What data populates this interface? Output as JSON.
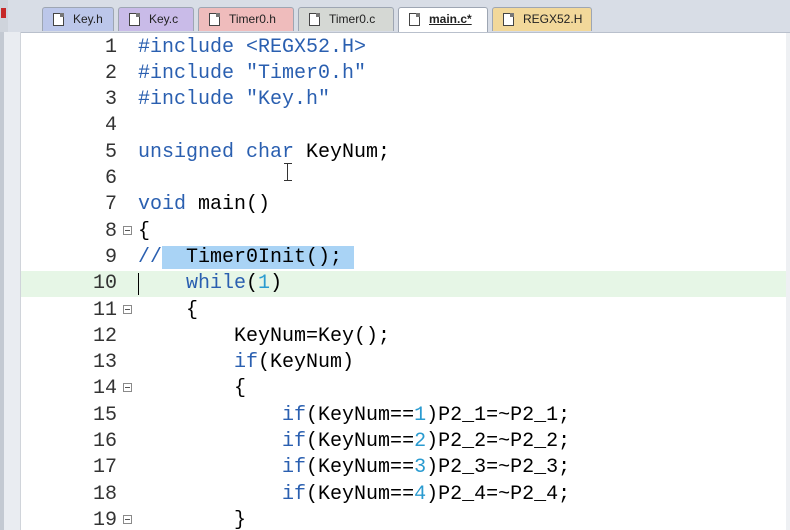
{
  "tabs": [
    {
      "label": "Key.h",
      "color": "#bcc7ea",
      "active": false
    },
    {
      "label": "Key.c",
      "color": "#c9bbe8",
      "active": false
    },
    {
      "label": "Timer0.h",
      "color": "#efbcbc",
      "active": false
    },
    {
      "label": "Timer0.c",
      "color": "#d5d8d4",
      "active": false
    },
    {
      "label": "main.c*",
      "color": "#ffffff",
      "active": true
    },
    {
      "label": "REGX52.H",
      "color": "#f2d89a",
      "active": false
    }
  ],
  "editor": {
    "current_line": 10,
    "lines": [
      {
        "n": "1",
        "text": "#include <REGX52.H>"
      },
      {
        "n": "2",
        "text": "#include \"Timer0.h\""
      },
      {
        "n": "3",
        "text": "#include \"Key.h\""
      },
      {
        "n": "4",
        "text": ""
      },
      {
        "n": "5",
        "text": "unsigned char KeyNum;"
      },
      {
        "n": "6",
        "text": ""
      },
      {
        "n": "7",
        "text": "void main()"
      },
      {
        "n": "8",
        "text": "{"
      },
      {
        "n": "9",
        "text": "//  Timer0Init();"
      },
      {
        "n": "10",
        "text": "    while(1)"
      },
      {
        "n": "11",
        "text": "    {"
      },
      {
        "n": "12",
        "text": "        KeyNum=Key();"
      },
      {
        "n": "13",
        "text": "        if(KeyNum)"
      },
      {
        "n": "14",
        "text": "        {"
      },
      {
        "n": "15",
        "text": "            if(KeyNum==1)P2_1=~P2_1;"
      },
      {
        "n": "16",
        "text": "            if(KeyNum==2)P2_2=~P2_2;"
      },
      {
        "n": "17",
        "text": "            if(KeyNum==3)P2_3=~P2_3;"
      },
      {
        "n": "18",
        "text": "            if(KeyNum==4)P2_4=~P2_4;"
      },
      {
        "n": "19",
        "text": "        }"
      }
    ],
    "fold_lines": [
      "8",
      "11",
      "14",
      "19"
    ],
    "selection_line": "9",
    "selected_text": "Timer0Init();"
  },
  "colors": {
    "keyword": "#2a5fb0",
    "number": "#2a9bd0",
    "comment": "#2e8b3d",
    "selection": "#a9d3f5",
    "current_line": "#e6f6e6",
    "breakpoint_marker": "#2aa4c9"
  }
}
